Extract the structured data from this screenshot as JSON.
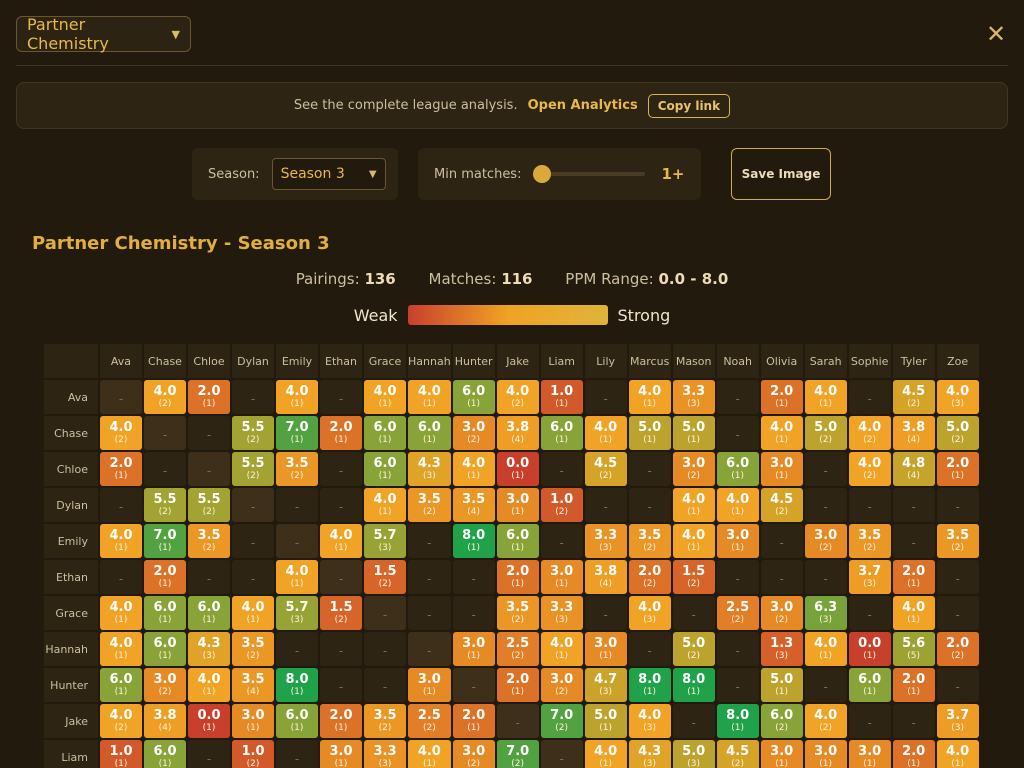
{
  "header": {
    "view_select": "Partner Chemistry",
    "close_symbol": "✕"
  },
  "banner": {
    "text": "See the complete league analysis.",
    "link": "Open Analytics",
    "copy": "Copy link"
  },
  "controls": {
    "season_label": "Season:",
    "season_value": "Season 3",
    "min_label": "Min matches:",
    "min_value": "1+",
    "save": "Save Image"
  },
  "title": "Partner Chemistry - Season 3",
  "stats": {
    "pairings_label": "Pairings:",
    "pairings": "136",
    "matches_label": "Matches:",
    "matches": "116",
    "range_label": "PPM Range:",
    "range": "0.0 - 8.0"
  },
  "legend": {
    "weak": "Weak",
    "strong": "Strong"
  },
  "colors": {
    "low": "#c8402c",
    "mid": "#f0a324",
    "high": "#1fa24a"
  },
  "players": [
    "Ava",
    "Chase",
    "Chloe",
    "Dylan",
    "Emily",
    "Ethan",
    "Grace",
    "Hannah",
    "Hunter",
    "Jake",
    "Liam",
    "Lily",
    "Marcus",
    "Mason",
    "Noah",
    "Olivia",
    "Sarah",
    "Sophie",
    "Tyler",
    "Zoe"
  ],
  "rows": [
    {
      "name": "Ava",
      "cells": [
        [
          "self"
        ],
        [
          "4.0",
          "(2)"
        ],
        [
          "2.0",
          "(1)"
        ],
        null,
        [
          "4.0",
          "(1)"
        ],
        null,
        [
          "4.0",
          "(1)"
        ],
        [
          "4.0",
          "(1)"
        ],
        [
          "6.0",
          "(1)"
        ],
        [
          "4.0",
          "(2)"
        ],
        [
          "1.0",
          "(1)"
        ],
        null,
        [
          "4.0",
          "(1)"
        ],
        [
          "3.3",
          "(3)"
        ],
        null,
        [
          "2.0",
          "(1)"
        ],
        [
          "4.0",
          "(1)"
        ],
        null,
        [
          "4.5",
          "(2)"
        ],
        [
          "4.0",
          "(3)"
        ]
      ]
    },
    {
      "name": "Chase",
      "cells": [
        [
          "4.0",
          "(2)"
        ],
        [
          "self"
        ],
        null,
        [
          "5.5",
          "(2)"
        ],
        [
          "7.0",
          "(1)"
        ],
        [
          "2.0",
          "(1)"
        ],
        [
          "6.0",
          "(1)"
        ],
        [
          "6.0",
          "(1)"
        ],
        [
          "3.0",
          "(2)"
        ],
        [
          "3.8",
          "(4)"
        ],
        [
          "6.0",
          "(1)"
        ],
        [
          "4.0",
          "(1)"
        ],
        [
          "5.0",
          "(1)"
        ],
        [
          "5.0",
          "(1)"
        ],
        null,
        [
          "4.0",
          "(1)"
        ],
        [
          "5.0",
          "(2)"
        ],
        [
          "4.0",
          "(2)"
        ],
        [
          "3.8",
          "(4)"
        ],
        [
          "5.0",
          "(2)"
        ]
      ]
    },
    {
      "name": "Chloe",
      "cells": [
        [
          "2.0",
          "(1)"
        ],
        null,
        [
          "self"
        ],
        [
          "5.5",
          "(2)"
        ],
        [
          "3.5",
          "(2)"
        ],
        null,
        [
          "6.0",
          "(1)"
        ],
        [
          "4.3",
          "(3)"
        ],
        [
          "4.0",
          "(1)"
        ],
        [
          "0.0",
          "(1)"
        ],
        null,
        [
          "4.5",
          "(2)"
        ],
        null,
        [
          "3.0",
          "(2)"
        ],
        [
          "6.0",
          "(1)"
        ],
        [
          "3.0",
          "(1)"
        ],
        null,
        [
          "4.0",
          "(2)"
        ],
        [
          "4.8",
          "(4)"
        ],
        [
          "2.0",
          "(1)"
        ]
      ]
    },
    {
      "name": "Dylan",
      "cells": [
        null,
        [
          "5.5",
          "(2)"
        ],
        [
          "5.5",
          "(2)"
        ],
        [
          "self"
        ],
        null,
        null,
        [
          "4.0",
          "(1)"
        ],
        [
          "3.5",
          "(2)"
        ],
        [
          "3.5",
          "(4)"
        ],
        [
          "3.0",
          "(1)"
        ],
        [
          "1.0",
          "(2)"
        ],
        null,
        null,
        [
          "4.0",
          "(1)"
        ],
        [
          "4.0",
          "(1)"
        ],
        [
          "4.5",
          "(2)"
        ],
        null,
        null,
        null,
        null
      ]
    },
    {
      "name": "Emily",
      "cells": [
        [
          "4.0",
          "(1)"
        ],
        [
          "7.0",
          "(1)"
        ],
        [
          "3.5",
          "(2)"
        ],
        null,
        [
          "self"
        ],
        [
          "4.0",
          "(1)"
        ],
        [
          "5.7",
          "(3)"
        ],
        null,
        [
          "8.0",
          "(1)"
        ],
        [
          "6.0",
          "(1)"
        ],
        null,
        [
          "3.3",
          "(3)"
        ],
        [
          "3.5",
          "(2)"
        ],
        [
          "4.0",
          "(1)"
        ],
        [
          "3.0",
          "(1)"
        ],
        null,
        [
          "3.0",
          "(2)"
        ],
        [
          "3.5",
          "(2)"
        ],
        null,
        [
          "3.5",
          "(2)"
        ]
      ]
    },
    {
      "name": "Ethan",
      "cells": [
        null,
        [
          "2.0",
          "(1)"
        ],
        null,
        null,
        [
          "4.0",
          "(1)"
        ],
        [
          "self"
        ],
        [
          "1.5",
          "(2)"
        ],
        null,
        null,
        [
          "2.0",
          "(1)"
        ],
        [
          "3.0",
          "(1)"
        ],
        [
          "3.8",
          "(4)"
        ],
        [
          "2.0",
          "(2)"
        ],
        [
          "1.5",
          "(2)"
        ],
        null,
        null,
        null,
        [
          "3.7",
          "(3)"
        ],
        [
          "2.0",
          "(1)"
        ],
        null
      ]
    },
    {
      "name": "Grace",
      "cells": [
        [
          "4.0",
          "(1)"
        ],
        [
          "6.0",
          "(1)"
        ],
        [
          "6.0",
          "(1)"
        ],
        [
          "4.0",
          "(1)"
        ],
        [
          "5.7",
          "(3)"
        ],
        [
          "1.5",
          "(2)"
        ],
        [
          "self"
        ],
        null,
        null,
        [
          "3.5",
          "(2)"
        ],
        [
          "3.3",
          "(3)"
        ],
        null,
        [
          "4.0",
          "(3)"
        ],
        null,
        [
          "2.5",
          "(2)"
        ],
        [
          "3.0",
          "(2)"
        ],
        [
          "6.3",
          "(3)"
        ],
        null,
        [
          "4.0",
          "(1)"
        ],
        null
      ]
    },
    {
      "name": "Hannah",
      "cells": [
        [
          "4.0",
          "(1)"
        ],
        [
          "6.0",
          "(1)"
        ],
        [
          "4.3",
          "(3)"
        ],
        [
          "3.5",
          "(2)"
        ],
        null,
        null,
        null,
        [
          "self"
        ],
        [
          "3.0",
          "(1)"
        ],
        [
          "2.5",
          "(2)"
        ],
        [
          "4.0",
          "(1)"
        ],
        [
          "3.0",
          "(1)"
        ],
        null,
        [
          "5.0",
          "(2)"
        ],
        null,
        [
          "1.3",
          "(3)"
        ],
        [
          "4.0",
          "(1)"
        ],
        [
          "0.0",
          "(1)"
        ],
        [
          "5.6",
          "(5)"
        ],
        [
          "2.0",
          "(2)"
        ]
      ]
    },
    {
      "name": "Hunter",
      "cells": [
        [
          "6.0",
          "(1)"
        ],
        [
          "3.0",
          "(2)"
        ],
        [
          "4.0",
          "(1)"
        ],
        [
          "3.5",
          "(4)"
        ],
        [
          "8.0",
          "(1)"
        ],
        null,
        null,
        [
          "3.0",
          "(1)"
        ],
        [
          "self"
        ],
        [
          "2.0",
          "(1)"
        ],
        [
          "3.0",
          "(2)"
        ],
        [
          "4.7",
          "(3)"
        ],
        [
          "8.0",
          "(1)"
        ],
        [
          "8.0",
          "(1)"
        ],
        null,
        [
          "5.0",
          "(1)"
        ],
        null,
        [
          "6.0",
          "(1)"
        ],
        [
          "2.0",
          "(1)"
        ],
        null
      ]
    },
    {
      "name": "Jake",
      "cells": [
        [
          "4.0",
          "(2)"
        ],
        [
          "3.8",
          "(4)"
        ],
        [
          "0.0",
          "(1)"
        ],
        [
          "3.0",
          "(1)"
        ],
        [
          "6.0",
          "(1)"
        ],
        [
          "2.0",
          "(1)"
        ],
        [
          "3.5",
          "(2)"
        ],
        [
          "2.5",
          "(2)"
        ],
        [
          "2.0",
          "(1)"
        ],
        [
          "self"
        ],
        [
          "7.0",
          "(2)"
        ],
        [
          "5.0",
          "(1)"
        ],
        [
          "4.0",
          "(3)"
        ],
        null,
        [
          "8.0",
          "(1)"
        ],
        [
          "6.0",
          "(2)"
        ],
        [
          "4.0",
          "(2)"
        ],
        null,
        null,
        [
          "3.7",
          "(3)"
        ]
      ]
    },
    {
      "name": "Liam",
      "cells": [
        [
          "1.0",
          "(1)"
        ],
        [
          "6.0",
          "(1)"
        ],
        null,
        [
          "1.0",
          "(2)"
        ],
        null,
        [
          "3.0",
          "(1)"
        ],
        [
          "3.3",
          "(3)"
        ],
        [
          "4.0",
          "(1)"
        ],
        [
          "3.0",
          "(2)"
        ],
        [
          "7.0",
          "(2)"
        ],
        [
          "self"
        ],
        [
          "4.0",
          "(1)"
        ],
        [
          "4.3",
          "(3)"
        ],
        [
          "5.0",
          "(3)"
        ],
        [
          "4.5",
          "(2)"
        ],
        [
          "3.0",
          "(1)"
        ],
        [
          "3.0",
          "(1)"
        ],
        [
          "3.0",
          "(1)"
        ],
        [
          "2.0",
          "(1)"
        ],
        [
          "4.0",
          "(1)"
        ]
      ]
    }
  ]
}
